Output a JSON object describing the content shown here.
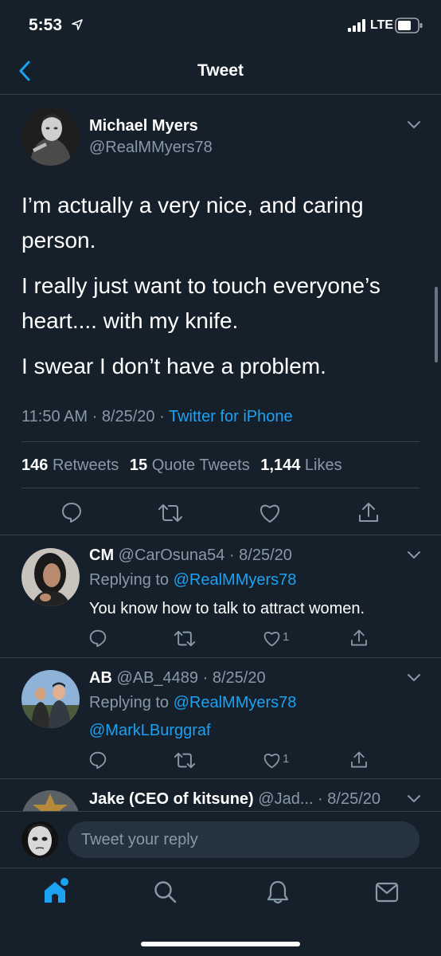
{
  "status_bar": {
    "time": "5:53",
    "network": "LTE"
  },
  "nav": {
    "title": "Tweet"
  },
  "tweet": {
    "author_name": "Michael Myers",
    "author_handle": "@RealMMyers78",
    "paragraphs": [
      "I’m actually a very nice, and caring",
      "person.",
      "I really just want to touch everyone’s",
      "heart.... with my knife.",
      "I swear I don’t have a problem."
    ],
    "time": "11:50 AM",
    "date": "8/25/20",
    "source": "Twitter for iPhone",
    "retweets_count": "146",
    "retweets_label": "Retweets",
    "quotes_count": "15",
    "quotes_label": "Quote Tweets",
    "likes_count": "1,144",
    "likes_label": "Likes"
  },
  "replies": [
    {
      "name": "CM",
      "handle": "@CarOsuna54",
      "date": "8/25/20",
      "replying_prefix": "Replying to",
      "replying_to": "@RealMMyers78",
      "text": "You know how to talk to attract women.",
      "like_count": "1"
    },
    {
      "name": "AB",
      "handle": "@AB_4489",
      "date": "8/25/20",
      "replying_prefix": "Replying to",
      "replying_to": "@RealMMyers78",
      "text": "@MarkLBurggraf",
      "like_count": "1"
    },
    {
      "name": "Jake (CEO of kitsune)",
      "handle": "@Jad...",
      "date": "8/25/20"
    }
  ],
  "composer": {
    "placeholder": "Tweet your reply"
  },
  "colors": {
    "background": "#15202b",
    "accent": "#1da1f2",
    "muted": "#8899a6",
    "divider": "#38444d"
  }
}
